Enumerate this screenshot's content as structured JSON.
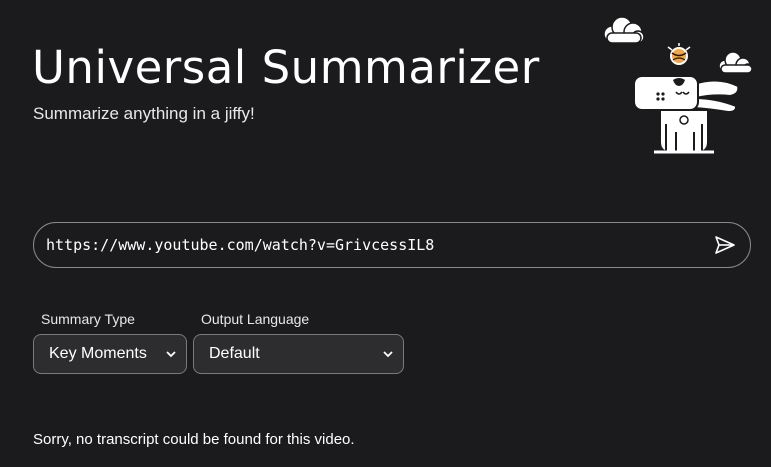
{
  "header": {
    "title": "Universal Summarizer",
    "subtitle": "Summarize anything in a jiffy!"
  },
  "url_input": {
    "value": "https://www.youtube.com/watch?v=GrivcessIL8",
    "submit_icon": "send-icon"
  },
  "options": {
    "summary_type": {
      "label": "Summary Type",
      "selected": "Key Moments"
    },
    "output_language": {
      "label": "Output Language",
      "selected": "Default"
    }
  },
  "result": {
    "message": "Sorry, no transcript could be found for this video."
  },
  "mascot": {
    "icon": "dog-mascot-illustration"
  },
  "colors": {
    "background": "#1b1b1d",
    "text": "#ffffff",
    "control_background": "#2d2d30",
    "border": "#8a8a8a",
    "ball": "#f4a640"
  }
}
